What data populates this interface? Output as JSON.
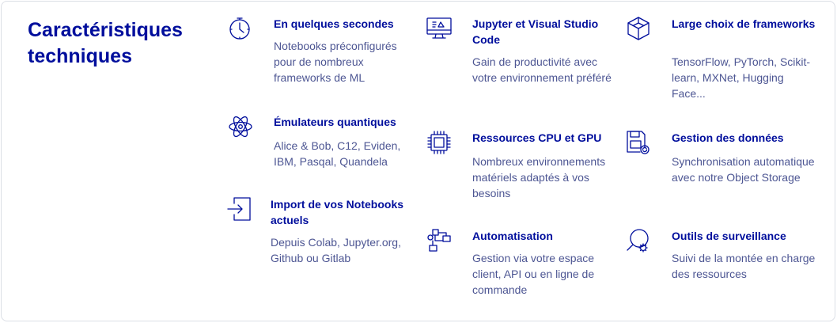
{
  "section": {
    "title": "Caractéristiques techniques"
  },
  "features": [
    {
      "icon": "stopwatch-icon",
      "title": "En quelques secondes",
      "desc": "Notebooks préconfigurés pour de nombreux frameworks de ML"
    },
    {
      "icon": "code-monitor-icon",
      "title": "Jupyter et Visual Studio Code",
      "desc": "Gain de productivité avec votre environnement préféré"
    },
    {
      "icon": "cube-icon",
      "title": "Large choix de frameworks",
      "desc": "TensorFlow, PyTorch, Scikit-learn, MXNet, Hugging Face..."
    },
    {
      "icon": "atom-icon",
      "title": "Émulateurs quantiques",
      "desc": "Alice & Bob, C12, Eviden, IBM, Pasqal, Quandela"
    },
    {
      "icon": "cpu-chip-icon",
      "title": "Ressources CPU et GPU",
      "desc": "Nombreux environnements matériels adaptés à vos besoins"
    },
    {
      "icon": "data-sync-icon",
      "title": "Gestion des données",
      "desc": "Synchronisation automatique avec notre Object Storage"
    },
    {
      "icon": "import-icon",
      "title": "Import de vos Notebooks actuels",
      "desc": "Depuis Colab, Jupyter.org, Github ou Gitlab"
    },
    {
      "icon": "automation-icon",
      "title": "Automatisation",
      "desc": "Gestion via votre espace client, API ou en ligne de commande"
    },
    {
      "icon": "monitoring-icon",
      "title": "Outils de surveillance",
      "desc": "Suivi de la montée en charge des ressources"
    }
  ]
}
